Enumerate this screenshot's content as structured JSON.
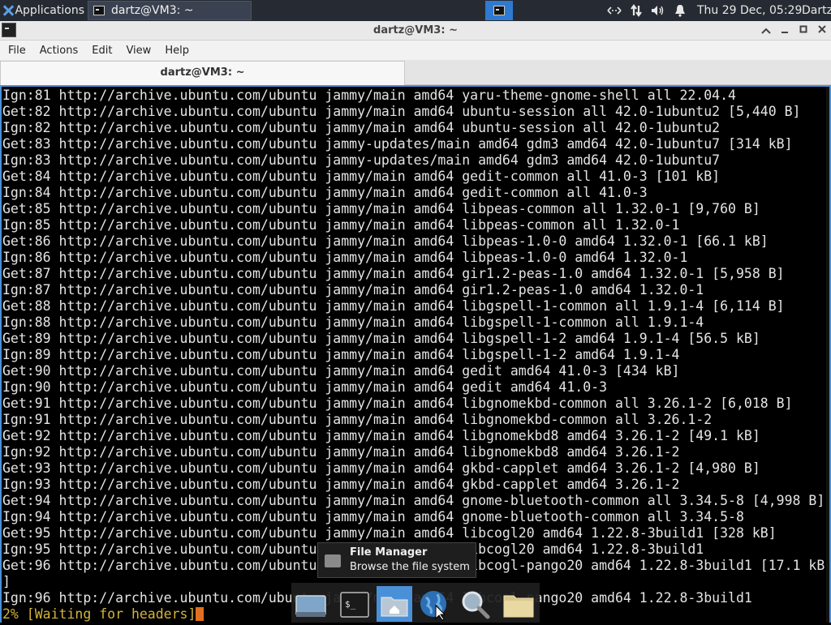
{
  "top_panel": {
    "applications_label": "Applications",
    "task_title": "dartz@VM3: ~",
    "clock": "Thu 29 Dec, 05:29",
    "username": "Dartz"
  },
  "window": {
    "title": "dartz@VM3: ~",
    "menu": [
      "File",
      "Actions",
      "Edit",
      "View",
      "Help"
    ],
    "tab_label": "dartz@VM3: ~"
  },
  "terminal": {
    "lines": [
      "Ign:81 http://archive.ubuntu.com/ubuntu jammy/main amd64 yaru-theme-gnome-shell all 22.04.4",
      "Get:82 http://archive.ubuntu.com/ubuntu jammy/main amd64 ubuntu-session all 42.0-1ubuntu2 [5,440 B]",
      "Ign:82 http://archive.ubuntu.com/ubuntu jammy/main amd64 ubuntu-session all 42.0-1ubuntu2",
      "Get:83 http://archive.ubuntu.com/ubuntu jammy-updates/main amd64 gdm3 amd64 42.0-1ubuntu7 [314 kB]",
      "Ign:83 http://archive.ubuntu.com/ubuntu jammy-updates/main amd64 gdm3 amd64 42.0-1ubuntu7",
      "Get:84 http://archive.ubuntu.com/ubuntu jammy/main amd64 gedit-common all 41.0-3 [101 kB]",
      "Ign:84 http://archive.ubuntu.com/ubuntu jammy/main amd64 gedit-common all 41.0-3",
      "Get:85 http://archive.ubuntu.com/ubuntu jammy/main amd64 libpeas-common all 1.32.0-1 [9,760 B]",
      "Ign:85 http://archive.ubuntu.com/ubuntu jammy/main amd64 libpeas-common all 1.32.0-1",
      "Get:86 http://archive.ubuntu.com/ubuntu jammy/main amd64 libpeas-1.0-0 amd64 1.32.0-1 [66.1 kB]",
      "Ign:86 http://archive.ubuntu.com/ubuntu jammy/main amd64 libpeas-1.0-0 amd64 1.32.0-1",
      "Get:87 http://archive.ubuntu.com/ubuntu jammy/main amd64 gir1.2-peas-1.0 amd64 1.32.0-1 [5,958 B]",
      "Ign:87 http://archive.ubuntu.com/ubuntu jammy/main amd64 gir1.2-peas-1.0 amd64 1.32.0-1",
      "Get:88 http://archive.ubuntu.com/ubuntu jammy/main amd64 libgspell-1-common all 1.9.1-4 [6,114 B]",
      "Ign:88 http://archive.ubuntu.com/ubuntu jammy/main amd64 libgspell-1-common all 1.9.1-4",
      "Get:89 http://archive.ubuntu.com/ubuntu jammy/main amd64 libgspell-1-2 amd64 1.9.1-4 [56.5 kB]",
      "Ign:89 http://archive.ubuntu.com/ubuntu jammy/main amd64 libgspell-1-2 amd64 1.9.1-4",
      "Get:90 http://archive.ubuntu.com/ubuntu jammy/main amd64 gedit amd64 41.0-3 [434 kB]",
      "Ign:90 http://archive.ubuntu.com/ubuntu jammy/main amd64 gedit amd64 41.0-3",
      "Get:91 http://archive.ubuntu.com/ubuntu jammy/main amd64 libgnomekbd-common all 3.26.1-2 [6,018 B]",
      "Ign:91 http://archive.ubuntu.com/ubuntu jammy/main amd64 libgnomekbd-common all 3.26.1-2",
      "Get:92 http://archive.ubuntu.com/ubuntu jammy/main amd64 libgnomekbd8 amd64 3.26.1-2 [49.1 kB]",
      "Ign:92 http://archive.ubuntu.com/ubuntu jammy/main amd64 libgnomekbd8 amd64 3.26.1-2",
      "Get:93 http://archive.ubuntu.com/ubuntu jammy/main amd64 gkbd-capplet amd64 3.26.1-2 [4,980 B]",
      "Ign:93 http://archive.ubuntu.com/ubuntu jammy/main amd64 gkbd-capplet amd64 3.26.1-2",
      "Get:94 http://archive.ubuntu.com/ubuntu jammy/main amd64 gnome-bluetooth-common all 3.34.5-8 [4,998 B]",
      "Ign:94 http://archive.ubuntu.com/ubuntu jammy/main amd64 gnome-bluetooth-common all 3.34.5-8",
      "Get:95 http://archive.ubuntu.com/ubuntu jammy/main amd64 libcogl20 amd64 1.22.8-3build1 [328 kB]",
      "Ign:95 http://archive.ubuntu.com/ubuntu jammy/main amd64 libcogl20 amd64 1.22.8-3build1",
      "Get:96 http://archive.ubuntu.com/ubuntu jammy/main amd64 libcogl-pango20 amd64 1.22.8-3build1 [17.1 kB",
      "]",
      "Ign:96 http://archive.ubuntu.com/ubuntu jammy/main amd64 libcogl-pango20 amd64 1.22.8-3build1"
    ],
    "progress_line": "2% [Waiting for headers]"
  },
  "tooltip": {
    "title": "File Manager",
    "subtitle": "Browse the file system"
  },
  "icons": {
    "applications_menu": "xfce-mouse-icon",
    "task_terminal": "terminal-icon",
    "workspace": "workspace-icon",
    "network": "network-icon",
    "transfer": "updown-arrows-icon",
    "volume": "speaker-icon",
    "notifications": "bell-icon",
    "dock_items": [
      "show-desktop-icon",
      "terminal-icon",
      "home-folder-icon",
      "web-browser-icon",
      "search-icon",
      "folder-icon"
    ]
  },
  "colors": {
    "panel_bg": "#262b33",
    "accent": "#4a90d9",
    "terminal_bg": "#000000",
    "terminal_fg": "#e4e4e4",
    "progress_fg": "#d4b43a",
    "cursor": "#e07020"
  }
}
